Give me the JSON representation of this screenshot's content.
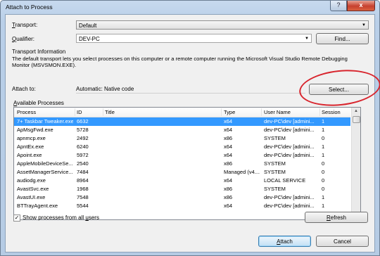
{
  "window": {
    "title": "Attach to Process",
    "help_label": "?",
    "close_label": "x"
  },
  "transport": {
    "label_prefix": "T",
    "label_rest": "ransport:",
    "value": "Default"
  },
  "qualifier": {
    "label_prefix": "Q",
    "label_rest": "ualifier:",
    "value": "DEV-PC",
    "find_button": "Find..."
  },
  "transport_info": {
    "heading": "Transport Information",
    "line1": "The default transport lets you select processes on this computer or a remote computer running the Microsoft Visual Studio Remote Debugging",
    "line2": "Monitor (MSVSMON.EXE)."
  },
  "attach_to": {
    "label": "Attach to:",
    "value": "Automatic: Native code",
    "select_button": "Select..."
  },
  "available": {
    "label_prefix": "A",
    "label_rest": "vailable Processes"
  },
  "columns": [
    "Process",
    "ID",
    "Title",
    "Type",
    "User Name",
    "Session"
  ],
  "processes": [
    {
      "process": "7+ Taskbar Tweaker.exe",
      "id": "6632",
      "title": "",
      "type": "x64",
      "user": "dev-PC\\dev [admini...",
      "session": "1",
      "selected": true
    },
    {
      "process": "ApMsgFwd.exe",
      "id": "5728",
      "title": "",
      "type": "x64",
      "user": "dev-PC\\dev [admini...",
      "session": "1"
    },
    {
      "process": "apnmcp.exe",
      "id": "2492",
      "title": "",
      "type": "x86",
      "user": "SYSTEM",
      "session": "0"
    },
    {
      "process": "ApntEx.exe",
      "id": "6240",
      "title": "",
      "type": "x64",
      "user": "dev-PC\\dev [admini...",
      "session": "1"
    },
    {
      "process": "Apoint.exe",
      "id": "5972",
      "title": "",
      "type": "x64",
      "user": "dev-PC\\dev [admini...",
      "session": "1"
    },
    {
      "process": "AppleMobileDeviceSe...",
      "id": "2540",
      "title": "",
      "type": "x86",
      "user": "SYSTEM",
      "session": "0"
    },
    {
      "process": "AssetManagerService....",
      "id": "7484",
      "title": "",
      "type": "Managed (v4....",
      "user": "SYSTEM",
      "session": "0"
    },
    {
      "process": "audiodg.exe",
      "id": "8964",
      "title": "",
      "type": "x64",
      "user": "LOCAL SERVICE",
      "session": "0"
    },
    {
      "process": "AvastSvc.exe",
      "id": "1968",
      "title": "",
      "type": "x86",
      "user": "SYSTEM",
      "session": "0"
    },
    {
      "process": "AvastUI.exe",
      "id": "7548",
      "title": "",
      "type": "x86",
      "user": "dev-PC\\dev [admini...",
      "session": "1"
    },
    {
      "process": "BTTrayAgent.exe",
      "id": "5544",
      "title": "",
      "type": "x64",
      "user": "dev-PC\\dev [admini...",
      "session": "1"
    }
  ],
  "show_all": {
    "label_pre": "Show processes from all ",
    "label_u": "u",
    "label_post": "sers",
    "checked": "✓"
  },
  "refresh_button": {
    "prefix": "R",
    "rest": "efresh"
  },
  "attach_button": {
    "prefix": "A",
    "rest": "ttach"
  },
  "cancel_button": "Cancel",
  "colors": {
    "selection": "#3399ff",
    "annotation_circle": "#d8242d"
  }
}
